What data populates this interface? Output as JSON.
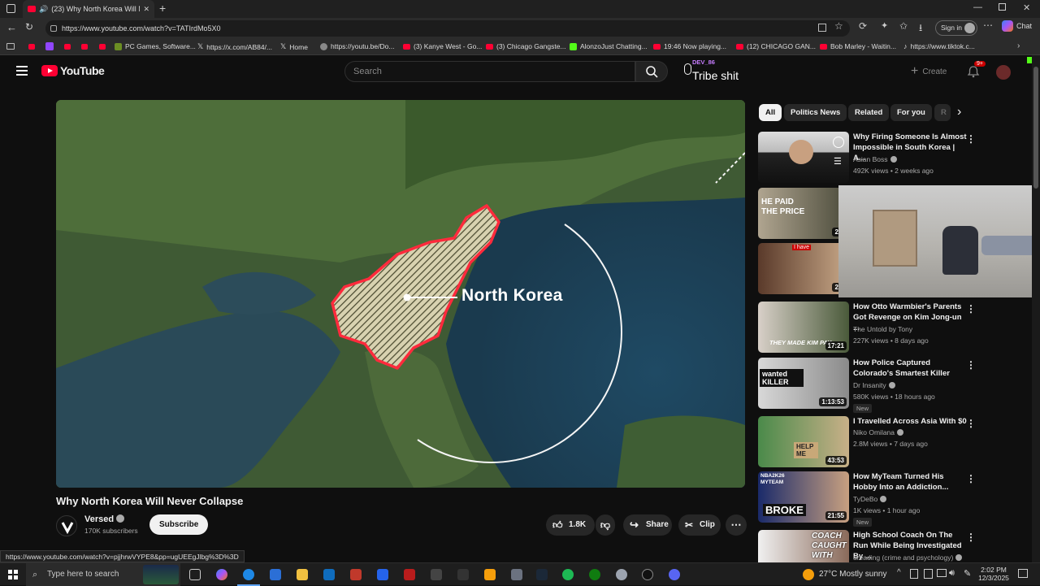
{
  "browser": {
    "tab_title": "(23) Why North Korea Will N...",
    "url": "https://www.youtube.com/watch?v=TATIrdMo5X0",
    "sign_in": "Sign in",
    "chat": "Chat",
    "bookmarks": [
      "PC Games, Software...",
      "https://x.com/AB84/...",
      "Home",
      "https://youtu.be/Do...",
      "(3) Kanye West - Go...",
      "(3) Chicago Gangste...",
      "AlonzoJust Chatting...",
      "19:46 Now playing...",
      "(12) CHICAGO GAN...",
      "Bob Marley - Waitin...",
      "https://www.tiktok.c..."
    ]
  },
  "header": {
    "logo_text": "YouTube",
    "search_placeholder": "Search",
    "create_label": "Create",
    "notif_count": "9+"
  },
  "overlay": {
    "tag": "DEV_86",
    "text": "Tribe shit"
  },
  "video": {
    "map_label": "North Korea",
    "title": "Why North Korea Will Never Collapse",
    "channel": "Versed",
    "subscribers": "170K subscribers",
    "subscribe_label": "Subscribe",
    "likes": "1.8K",
    "share_label": "Share",
    "clip_label": "Clip"
  },
  "chips": [
    "All",
    "Politics News",
    "Related",
    "For you",
    "R"
  ],
  "recommendations": [
    {
      "title": "Why Firing Someone Is Almost Impossible in South Korea | A...",
      "channel": "Asian Boss",
      "meta": "492K views • 2 weeks ago",
      "duration": "",
      "new": ""
    },
    {
      "title": "",
      "channel": "",
      "meta": "",
      "duration": "22:",
      "thumb_text": "HE PAID THE PRICE",
      "new": ""
    },
    {
      "title": "",
      "channel": "",
      "meta": "",
      "duration": "25:",
      "thumb_text": "I have",
      "new": ""
    },
    {
      "title": "How Otto Warmbier's Parents Got Revenge on Kim Jong-un ...",
      "channel": "The Untold by Tony",
      "meta": "227K views • 8 days ago",
      "duration": "17:21",
      "thumb_text": "THEY MADE KIM PAY",
      "new": ""
    },
    {
      "title": "How Police Captured Colorado's Smartest Killer",
      "channel": "Dr Insanity",
      "meta": "580K views • 18 hours ago",
      "duration": "1:13:53",
      "thumb_text": "wanted KILLER",
      "new": "New"
    },
    {
      "title": "I Travelled Across Asia With $0",
      "channel": "Niko Omilana",
      "meta": "2.8M views • 7 days ago",
      "duration": "43:53",
      "thumb_text": "HELP ME",
      "new": ""
    },
    {
      "title": "How MyTeam Turned His Hobby Into an Addiction...",
      "channel": "TyDeBo",
      "meta": "1K views • 1 hour ago",
      "duration": "21:55",
      "thumb_text": "BROKE",
      "thumb_text2": "NBA2K26 MYTEAM",
      "new": "New"
    },
    {
      "title": "High School Coach On The Run While Being Investigated By ...",
      "channel": "dreading (crime and psychology)",
      "meta": "",
      "duration": "",
      "thumb_text": "COACH CAUGHT WITH",
      "new": ""
    }
  ],
  "status_url": "https://www.youtube.com/watch?v=pjjhrwVYPE8&pp=ugUEEgJlbg%3D%3D",
  "taskbar": {
    "search_placeholder": "Type here to search",
    "weather": "27°C  Mostly sunny",
    "time": "2:02 PM",
    "date": "12/3/2025"
  },
  "colors": {
    "bg": "#0f0f0f",
    "youtube_red": "#ff0033",
    "map_outline": "#ff2a3c"
  }
}
